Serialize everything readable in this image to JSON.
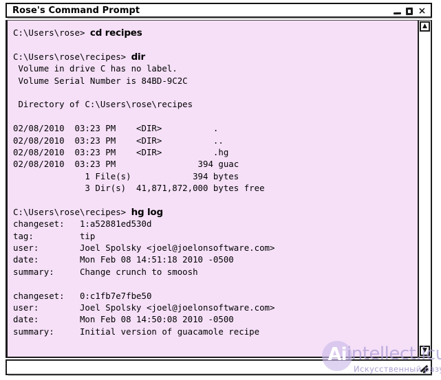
{
  "window": {
    "title": "Rose's Command Prompt",
    "controls": {
      "minimize": "minimize",
      "maximize": "maximize",
      "close": "×"
    }
  },
  "colors": {
    "terminal_background": "#f6e0f8",
    "terminal_text": "#000000",
    "window_border": "#1c1c1c",
    "titlebar_background": "#ffffff",
    "watermark": "#a99ad4"
  },
  "scrollbar": {
    "up_arrow": "▲",
    "down_arrow": "▼"
  },
  "terminal": {
    "lines": [
      {
        "text": "C:\\Users\\rose> ",
        "command": "cd recipes"
      },
      {
        "text": ""
      },
      {
        "text": "C:\\Users\\rose\\recipes> ",
        "command": "dir"
      },
      {
        "text": " Volume in drive C has no label."
      },
      {
        "text": " Volume Serial Number is 84BD-9C2C"
      },
      {
        "text": ""
      },
      {
        "text": " Directory of C:\\Users\\rose\\recipes"
      },
      {
        "text": ""
      },
      {
        "text": "02/08/2010  03:23 PM    <DIR>          ."
      },
      {
        "text": "02/08/2010  03:23 PM    <DIR>          .."
      },
      {
        "text": "02/08/2010  03:23 PM    <DIR>          .hg"
      },
      {
        "text": "02/08/2010  03:23 PM                394 guac"
      },
      {
        "text": "              1 File(s)            394 bytes"
      },
      {
        "text": "              3 Dir(s)  41,871,872,000 bytes free"
      },
      {
        "text": ""
      },
      {
        "text": "C:\\Users\\rose\\recipes> ",
        "command": "hg log"
      },
      {
        "text": "changeset:   1:a52881ed530d"
      },
      {
        "text": "tag:         tip"
      },
      {
        "text": "user:        Joel Spolsky <joel@joelonsoftware.com>"
      },
      {
        "text": "date:        Mon Feb 08 14:51:18 2010 -0500"
      },
      {
        "text": "summary:     Change crunch to smoosh"
      },
      {
        "text": ""
      },
      {
        "text": "changeset:   0:c1fb7e7fbe50"
      },
      {
        "text": "user:        Joel Spolsky <joel@joelonsoftware.com>"
      },
      {
        "text": "date:        Mon Feb 08 14:50:08 2010 -0500"
      },
      {
        "text": "summary:     Initial version of guacamole recipe"
      }
    ]
  },
  "watermark": {
    "badge": "Ai",
    "title": "intellect.icu",
    "subtitle": "Искусственный разум"
  }
}
